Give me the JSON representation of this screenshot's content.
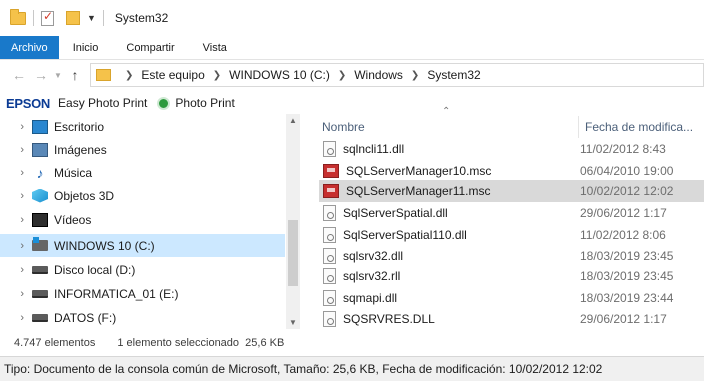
{
  "window": {
    "title": "System32"
  },
  "ribbon": {
    "tabs": [
      {
        "label": "Archivo",
        "active": true
      },
      {
        "label": "Inicio"
      },
      {
        "label": "Compartir"
      },
      {
        "label": "Vista"
      }
    ]
  },
  "address": {
    "breadcrumb": [
      "Este equipo",
      "WINDOWS 10 (C:)",
      "Windows",
      "System32"
    ]
  },
  "epson_toolbar": {
    "logo": "EPSON",
    "easy_photo_print": "Easy Photo Print",
    "photo_print": "Photo Print"
  },
  "nav_pane": {
    "items": [
      {
        "label": "Escritorio",
        "icon": "desktop-icon"
      },
      {
        "label": "Imágenes",
        "icon": "pictures-icon"
      },
      {
        "label": "Música",
        "icon": "music-icon"
      },
      {
        "label": "Objetos 3D",
        "icon": "3d-objects-icon"
      },
      {
        "label": "Vídeos",
        "icon": "videos-icon"
      },
      {
        "label": "WINDOWS 10 (C:)",
        "icon": "windows-drive-icon",
        "selected": true
      },
      {
        "label": "Disco local (D:)",
        "icon": "drive-icon"
      },
      {
        "label": "INFORMATICA_01 (E:)",
        "icon": "drive-icon"
      },
      {
        "label": "DATOS (F:)",
        "icon": "drive-icon"
      }
    ]
  },
  "file_list": {
    "columns": {
      "name": "Nombre",
      "date": "Fecha de modifica..."
    },
    "rows": [
      {
        "name": "sqlncli11.dll",
        "date": "11/02/2012 8:43",
        "type": "dll"
      },
      {
        "name": "SQLServerManager10.msc",
        "date": "06/04/2010 19:00",
        "type": "msc"
      },
      {
        "name": "SQLServerManager11.msc",
        "date": "10/02/2012 12:02",
        "type": "msc",
        "selected": true
      },
      {
        "name": "SqlServerSpatial.dll",
        "date": "29/06/2012 1:17",
        "type": "dll"
      },
      {
        "name": "SqlServerSpatial110.dll",
        "date": "11/02/2012 8:06",
        "type": "dll"
      },
      {
        "name": "sqlsrv32.dll",
        "date": "18/03/2019 23:45",
        "type": "dll"
      },
      {
        "name": "sqlsrv32.rll",
        "date": "18/03/2019 23:45",
        "type": "dll"
      },
      {
        "name": "sqmapi.dll",
        "date": "18/03/2019 23:44",
        "type": "dll"
      },
      {
        "name": "SQSRVRES.DLL",
        "date": "29/06/2012 1:17",
        "type": "dll"
      }
    ]
  },
  "status": {
    "count": "4.747 elementos",
    "selection": "1 elemento seleccionado  25,6 KB"
  },
  "info": "Tipo: Documento de la consola común de Microsoft, Tamaño: 25,6 KB, Fecha de modificación: 10/02/2012 12:02"
}
